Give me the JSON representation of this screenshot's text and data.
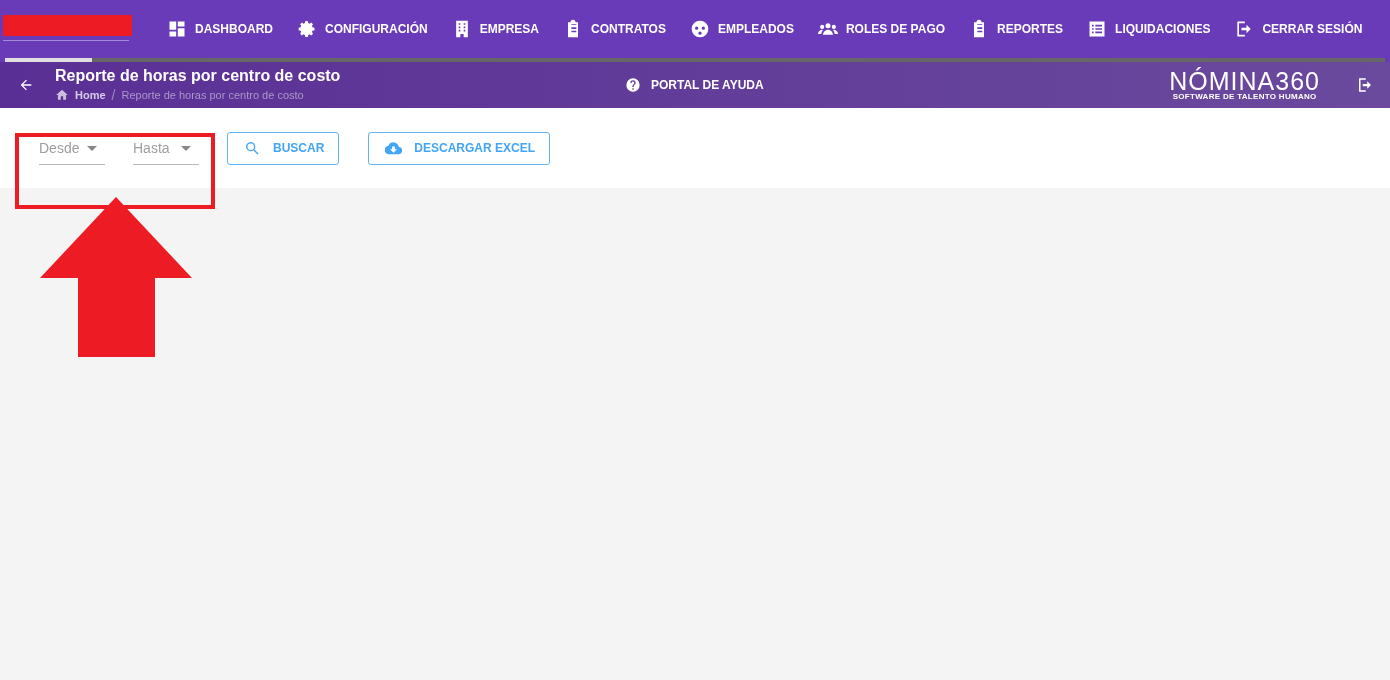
{
  "nav": {
    "items": [
      {
        "label": "DASHBOARD"
      },
      {
        "label": "CONFIGURACIÓN"
      },
      {
        "label": "EMPRESA"
      },
      {
        "label": "CONTRATOS"
      },
      {
        "label": "EMPLEADOS"
      },
      {
        "label": "ROLES DE PAGO"
      },
      {
        "label": "REPORTES"
      },
      {
        "label": "LIQUIDACIONES"
      },
      {
        "label": "CERRAR SESIÓN"
      }
    ],
    "progress": {
      "level": 0.063
    }
  },
  "header": {
    "title": "Reporte de horas por centro de costo",
    "breadcrumb": [
      {
        "label": "Home"
      },
      {
        "label": "Reporte de horas por centro de costo"
      }
    ],
    "separator": "/",
    "help": "PORTAL DE AYUDA",
    "logo": {
      "name": "NÓMINA360",
      "tagline": "SOFTWARE DE TALENTO HUMANO"
    }
  },
  "filters": [
    {
      "placeholder": "Desde"
    },
    {
      "placeholder": "Hasta"
    }
  ],
  "buttons": [
    {
      "label": "BUSCAR",
      "kind": "search"
    },
    {
      "label": "DESCARGAR EXCEL",
      "kind": "download"
    }
  ]
}
